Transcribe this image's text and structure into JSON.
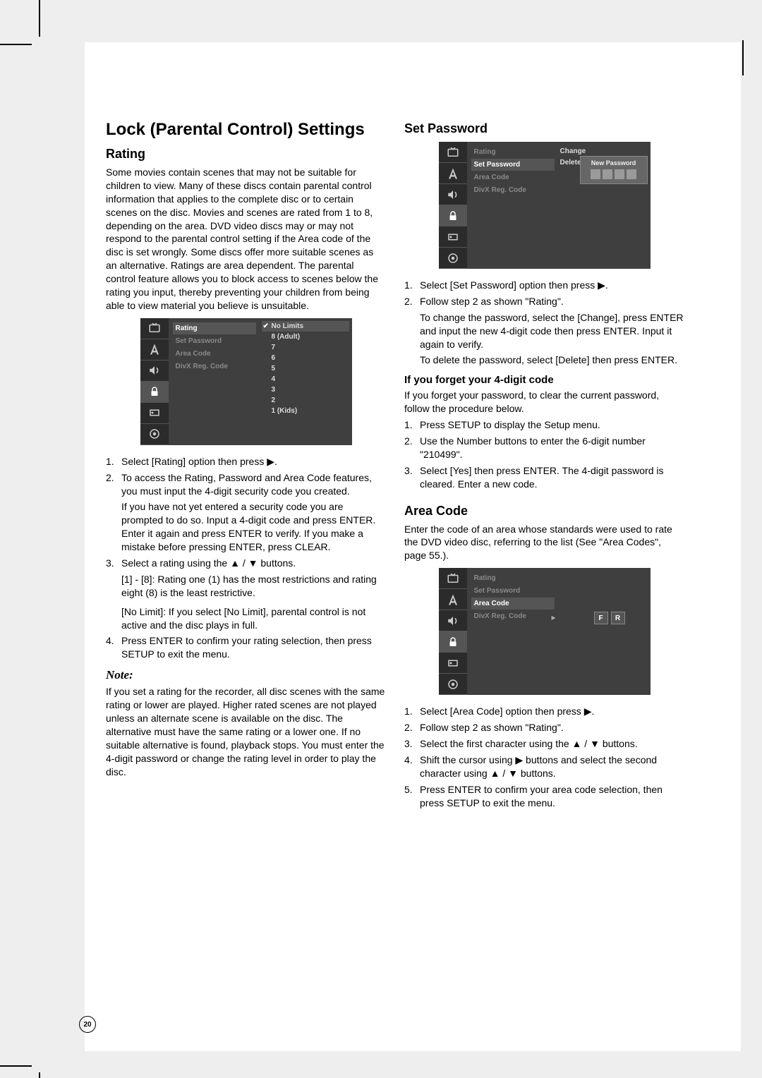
{
  "page_number": "20",
  "title": "Lock (Parental Control) Settings",
  "glyphs": {
    "right": "▶",
    "up": "▲",
    "down": "▼",
    "check": "✔"
  },
  "osd_menu": {
    "items": [
      "Rating",
      "Set Password",
      "Area Code",
      "DivX Reg. Code"
    ],
    "rating_values_top": "No Limits",
    "rating_values": [
      "8  (Adult)",
      "7",
      "6",
      "5",
      "4",
      "3",
      "2",
      "1  (Kids)"
    ],
    "password_actions": [
      "Change",
      "Delete"
    ],
    "new_password_label": "New Password",
    "area_code_value": [
      "F",
      "R"
    ]
  },
  "left": {
    "rating_heading": "Rating",
    "rating_intro": "Some movies contain scenes that may not be suitable for children to view. Many of these discs contain parental control information that applies to the complete disc or to certain scenes on the disc. Movies and scenes are rated from 1 to 8, depending on the area. DVD video discs may or may not respond to the parental control setting if the Area code of the disc is set wrongly. Some discs offer more suitable scenes as an alternative. Ratings are area dependent. The parental control feature allows you to block access to scenes below the rating you input, thereby preventing your children from being able to view material you believe is unsuitable.",
    "steps": {
      "s1": "Select [Rating] option then press ▶.",
      "s2": "To access the Rating, Password and Area Code features, you must input the 4-digit security code you created.",
      "s2b": "If you have not yet entered a security code you are prompted to do so. Input a 4-digit code and press ENTER. Enter it again and press ENTER to verify. If you make a mistake before pressing ENTER, press CLEAR.",
      "s3": "Select a rating using the ▲ / ▼ buttons.",
      "s3b": "[1] - [8]: Rating one (1) has the most restrictions and rating eight (8) is the least restrictive.",
      "s3c": "[No Limit]: If you select [No Limit], parental control is not active and the disc plays in full.",
      "s4": "Press ENTER to confirm your rating selection, then press SETUP to exit the menu."
    },
    "note_label": "Note:",
    "note_body": "If you set a rating for the recorder, all disc scenes with the same rating or lower are played. Higher rated scenes are not played unless an alternate scene is available on the disc. The alternative must have the same rating or a lower one. If no suitable alternative is found, playback stops. You must enter the 4-digit password or change the rating level in order to play the disc."
  },
  "right": {
    "setpw_heading": "Set Password",
    "setpw_steps": {
      "s1": "Select [Set Password] option then press ▶.",
      "s2": "Follow step 2 as shown \"Rating\".",
      "s2b": "To change the password, select the [Change], press ENTER and input the new 4-digit code then press ENTER. Input it again to verify.",
      "s2c": "To delete the password, select [Delete] then press ENTER."
    },
    "forgot_heading": "If you forget your 4-digit code",
    "forgot_intro": "If you forget your password, to clear the current password, follow the procedure below.",
    "forgot_steps": {
      "s1": "Press SETUP to display the Setup menu.",
      "s2": "Use the Number buttons to enter the 6-digit number \"210499\".",
      "s3": "Select [Yes] then press ENTER. The 4-digit password is cleared. Enter a new code."
    },
    "area_heading": "Area Code",
    "area_intro": "Enter the code of an area whose standards were used to rate the DVD video disc, referring to the list (See \"Area Codes\", page 55.).",
    "area_steps": {
      "s1": "Select [Area Code] option then press ▶.",
      "s2": "Follow step 2 as shown \"Rating\".",
      "s3": "Select the first character using the ▲ / ▼ buttons.",
      "s4": "Shift the cursor using ▶ buttons and select the second character using ▲ / ▼ buttons.",
      "s5": "Press ENTER to confirm your area code selection, then press SETUP to exit the menu."
    }
  }
}
